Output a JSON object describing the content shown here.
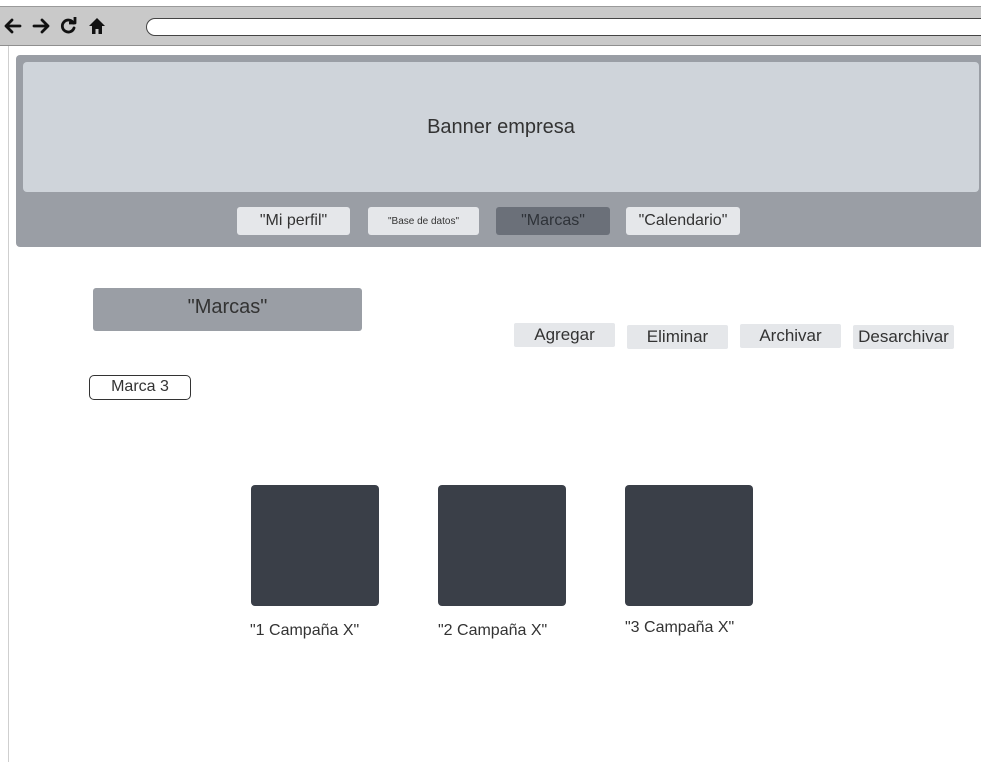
{
  "browser": {
    "back_icon": "arrow-left-icon",
    "forward_icon": "arrow-right-icon",
    "reload_icon": "reload-icon",
    "home_icon": "home-icon",
    "url": ""
  },
  "header": {
    "banner_text": "Banner empresa",
    "nav": [
      {
        "label": "\"Mi perfil\""
      },
      {
        "label": "\"Base de datos\""
      },
      {
        "label": "\"Marcas\"",
        "active": true
      },
      {
        "label": "\"Calendario\""
      }
    ]
  },
  "main": {
    "title": "\"Marcas\"",
    "actions": {
      "add": "Agregar",
      "delete": "Eliminar",
      "archive": "Archivar",
      "unarchive": "Desarchivar"
    },
    "brand_selector": "Marca 3",
    "campaigns": [
      {
        "label": "\"1 Campaña X\""
      },
      {
        "label": "\"2 Campaña X\""
      },
      {
        "label": "\"3 Campaña X\""
      }
    ]
  },
  "colors": {
    "header_bg": "#9a9ea5",
    "banner_bg": "#cfd4da",
    "nav_active": "#6b7079",
    "button_bg": "#e5e7ea",
    "card_bg": "#3a3f48"
  }
}
